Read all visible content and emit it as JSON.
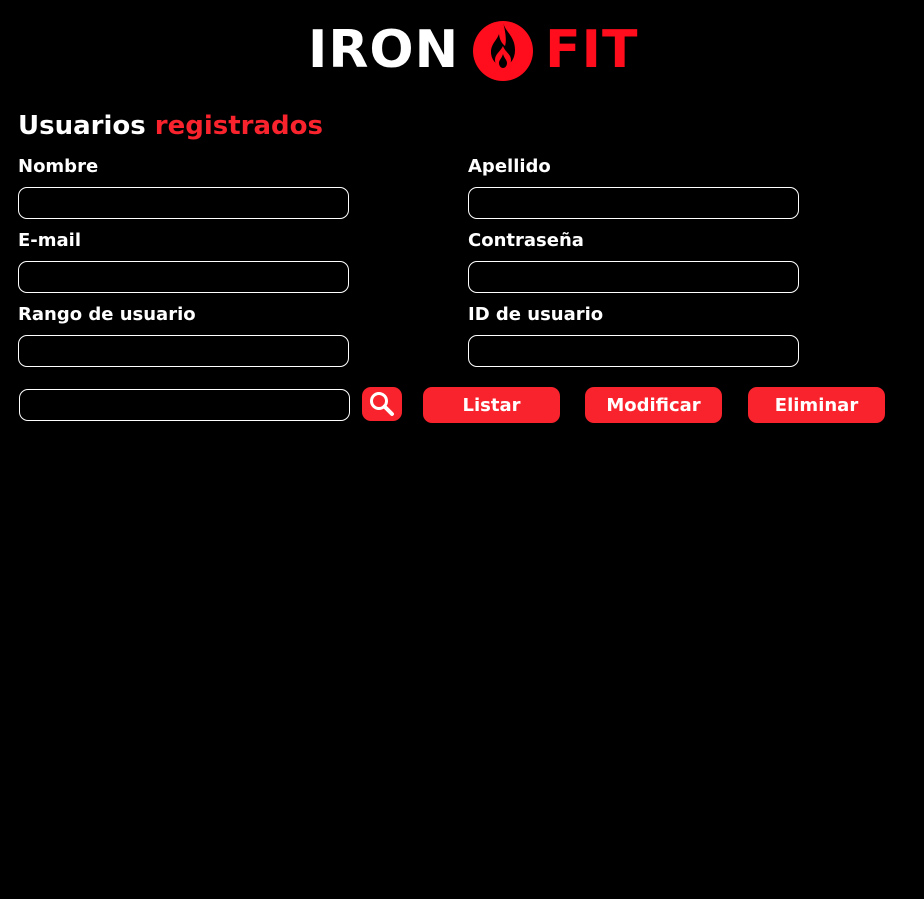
{
  "brand": {
    "word_left": "IRON",
    "word_right": "FIT",
    "logo_icon": "flame-icon",
    "white": "#ffffff",
    "accent": "#ff0d1c"
  },
  "section": {
    "title_main": "Usuarios",
    "title_accent": "registrados",
    "accent_color": "#f8232c"
  },
  "form": {
    "nombre_label": "Nombre",
    "apellido_label": "Apellido",
    "email_label": "E-mail",
    "password_label": "Contraseña",
    "rango_label": "Rango de usuario",
    "id_label": "ID de usuario",
    "nombre_value": "",
    "apellido_value": "",
    "email_value": "",
    "password_value": "",
    "rango_value": "",
    "id_value": ""
  },
  "actions": {
    "search_value": "",
    "search_icon": "search-icon",
    "listar_label": "Listar",
    "modificar_label": "Modificar",
    "eliminar_label": "Eliminar",
    "button_color": "#f8232c"
  }
}
